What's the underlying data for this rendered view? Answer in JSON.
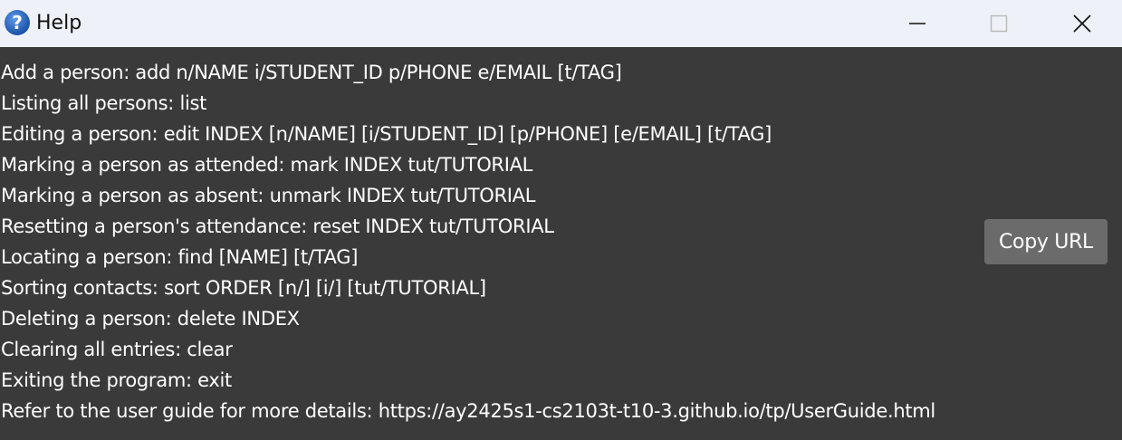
{
  "window": {
    "title": "Help",
    "icon": "question-icon",
    "controls": {
      "minimize": "minimize-icon",
      "maximize": "maximize-icon",
      "close": "close-icon"
    }
  },
  "help": {
    "lines": [
      "Add a person: add n/NAME i/STUDENT_ID p/PHONE e/EMAIL [t/TAG]",
      "Listing all persons: list",
      "Editing a person: edit INDEX [n/NAME] [i/STUDENT_ID] [p/PHONE] [e/EMAIL] [t/TAG]",
      "Marking a person as attended: mark INDEX tut/TUTORIAL",
      "Marking a person as absent: unmark INDEX tut/TUTORIAL",
      "Resetting a person's attendance: reset INDEX tut/TUTORIAL",
      "Locating a person: find [NAME] [t/TAG]",
      "Sorting contacts: sort ORDER [n/] [i/] [tut/TUTORIAL]",
      "Deleting a person: delete INDEX",
      "Clearing all entries: clear",
      "Exiting the program: exit",
      "Refer to the user guide for more details: https://ay2425s1-cs2103t-t10-3.github.io/tp/UserGuide.html"
    ],
    "copy_button_label": "Copy URL"
  },
  "colors": {
    "background": "#3a3a3a",
    "titlebar": "#eef1f8",
    "button": "#6b6b6b",
    "text": "#ffffff",
    "icon_blue": "#1f5fbf"
  }
}
